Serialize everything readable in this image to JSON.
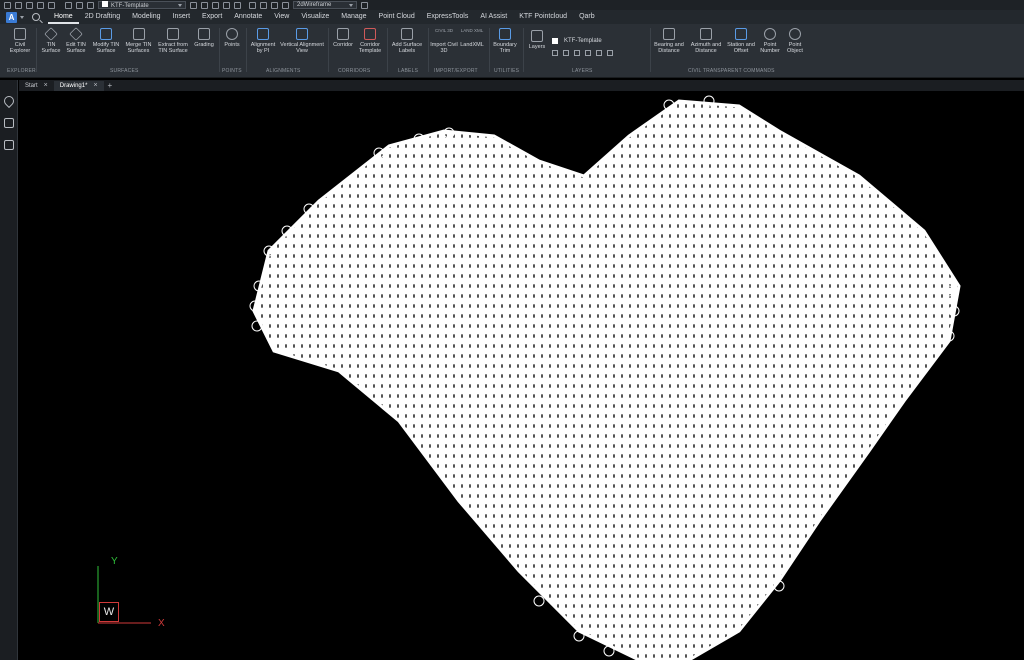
{
  "quick_access": {
    "layer_combo": "KTF-Template",
    "visual_style": "2dWireframe"
  },
  "menu": {
    "logo": "A",
    "tabs": [
      "Home",
      "2D Drafting",
      "Modeling",
      "Insert",
      "Export",
      "Annotate",
      "View",
      "Visualize",
      "Manage",
      "Point Cloud",
      "ExpressTools",
      "AI Assist",
      "KTF Pointcloud",
      "Qarb"
    ]
  },
  "ribbon": {
    "tools": {
      "civil_explorer": "Civil Explorer",
      "tin_surface": "TIN Surface",
      "edit_tin": "Edit TIN Surface",
      "modify_tin": "Modify TIN Surface",
      "merge_tin": "Merge TIN Surfaces",
      "extract_tin": "Extract from TIN Surface",
      "grading": "Grading",
      "points": "Points",
      "alignment_pi": "Alignment by PI",
      "vertical_alignment": "Vertical Alignment View",
      "corridor": "Corridor",
      "corridor_template": "Corridor Template",
      "add_surface_labels": "Add Surface Labels",
      "import_civil3d": "Import Civil 3D",
      "landxml": "LandXML",
      "boundary_trim": "Boundary Trim",
      "layers": "Layers",
      "layer_name": "KTF-Template",
      "bearing_distance": "Bearing and Distance",
      "azimuth_distance": "Azimuth and Distance",
      "station_offset": "Station and Offset",
      "point_number": "Point Number",
      "point_object": "Point Object",
      "civil3d_small": "CIVIL 3D",
      "landxml_small": "LAND XML"
    },
    "panels": {
      "explorer": "EXPLORER",
      "surfaces": "SURFACES",
      "points": "POINTS",
      "alignments": "ALIGNMENTS",
      "corridors": "CORRIDORS",
      "labels": "LABELS",
      "import_export": "IMPORT/EXPORT",
      "utilities": "UTILITIES",
      "layers": "LAYERS",
      "civil_transparent": "CIVIL TRANSPARENT COMMANDS"
    }
  },
  "doc_tabs": {
    "start": "Start",
    "drawing": "Drawing1*",
    "close": "×",
    "new": "+"
  },
  "ucs": {
    "x": "X",
    "y": "Y",
    "w": "W"
  },
  "colors": {
    "accent": "#3a7bd5",
    "ucs_x": "#d03a3a",
    "ucs_y": "#2fbf3a"
  }
}
